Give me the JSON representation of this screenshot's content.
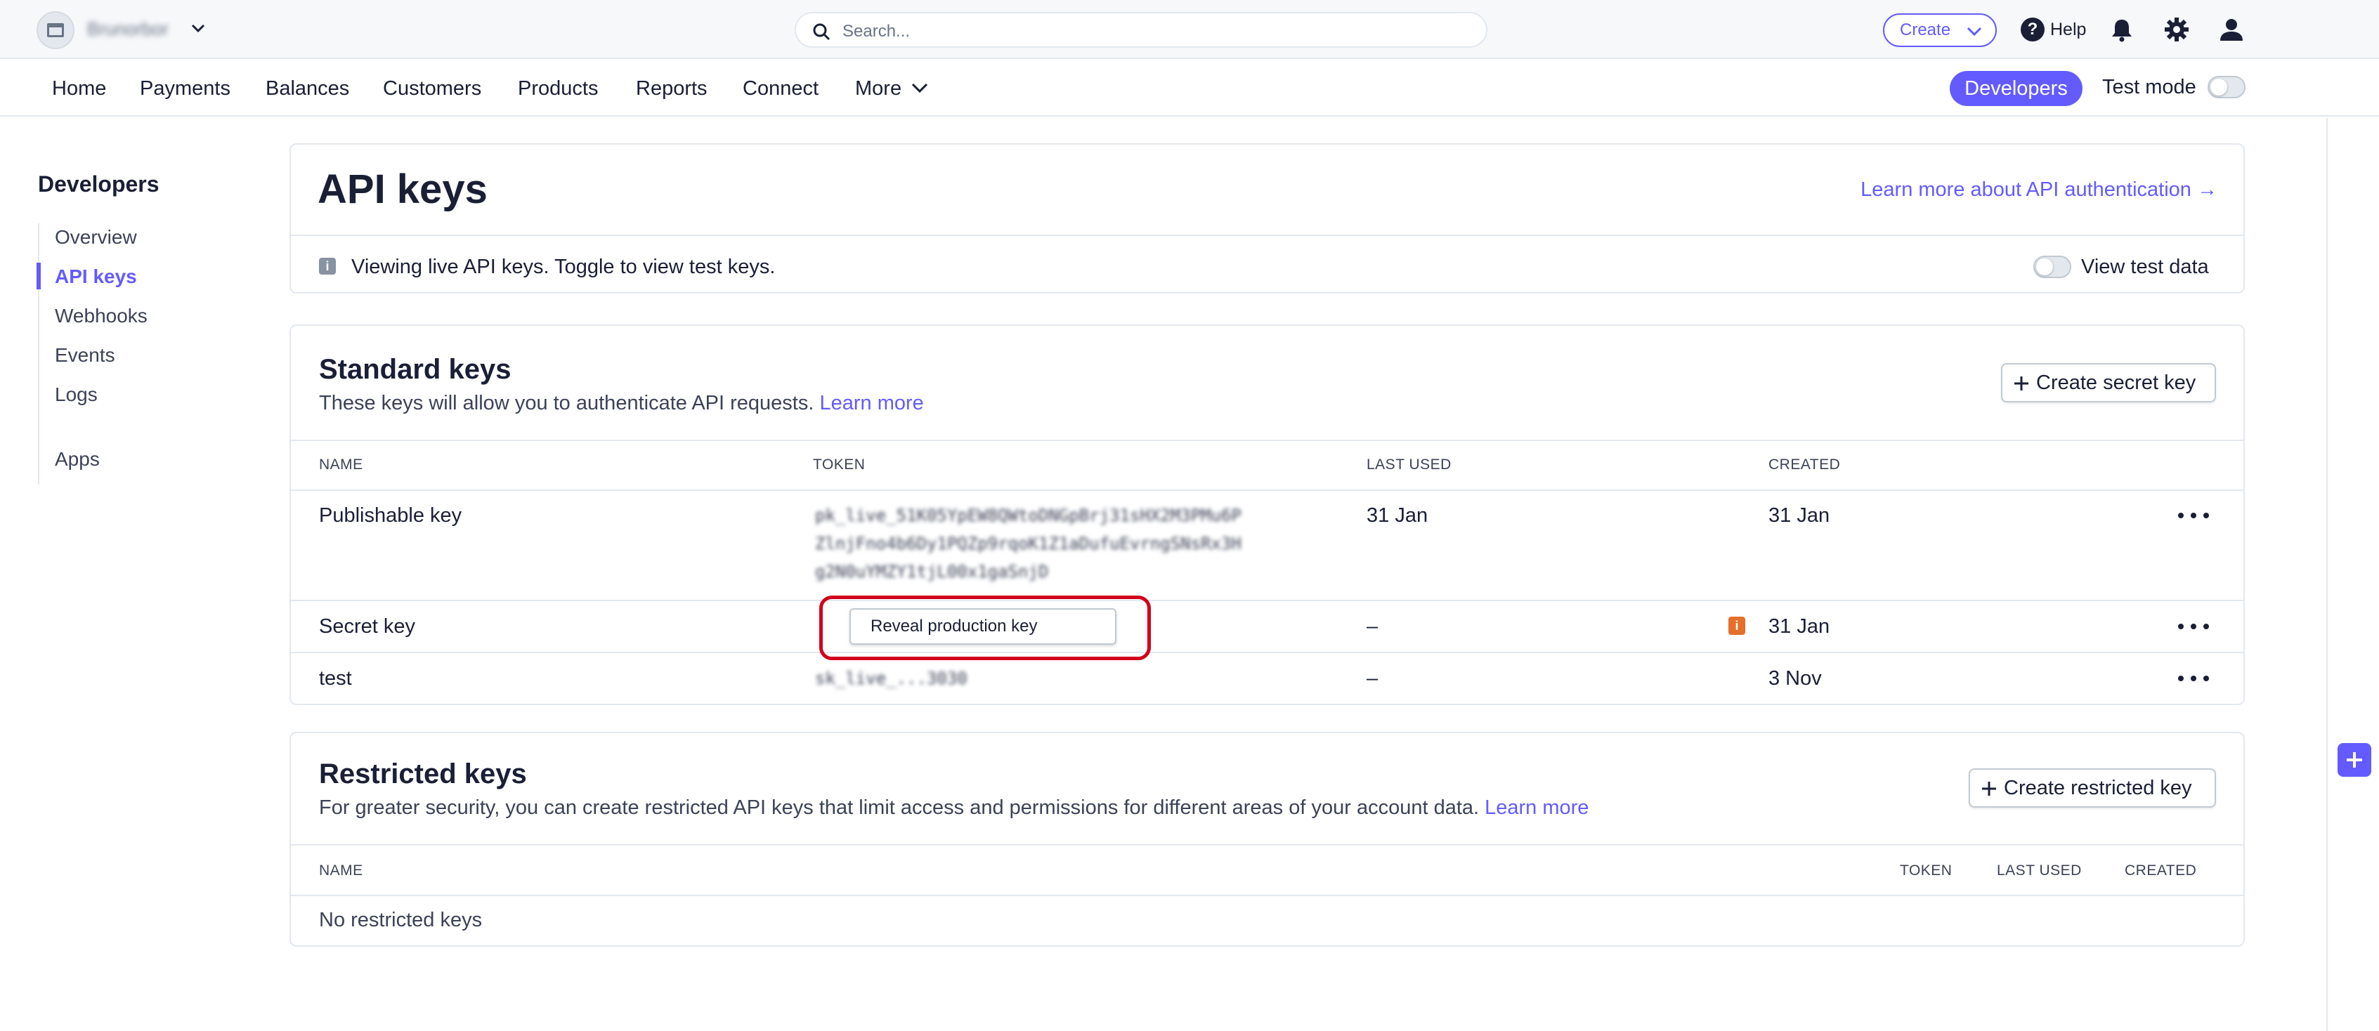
{
  "topbar": {
    "account_name": "Brunorbor",
    "search_placeholder": "Search...",
    "create_label": "Create",
    "help_label": "Help"
  },
  "nav": {
    "items": [
      "Home",
      "Payments",
      "Balances",
      "Customers",
      "Products",
      "Reports",
      "Connect",
      "More"
    ],
    "developers_label": "Developers",
    "test_mode_label": "Test mode"
  },
  "sidebar": {
    "title": "Developers",
    "items": [
      "Overview",
      "API keys",
      "Webhooks",
      "Events",
      "Logs",
      "Apps"
    ],
    "active": "API keys"
  },
  "page": {
    "title": "API keys",
    "learn_more_auth": "Learn more about API authentication →",
    "info_text": "Viewing live API keys. Toggle to view test keys.",
    "view_test_data": "View test data"
  },
  "standard_keys": {
    "title": "Standard keys",
    "subtitle": "These keys will allow you to authenticate API requests.",
    "learn_more": "Learn more",
    "create_button": "Create secret key",
    "columns": [
      "NAME",
      "TOKEN",
      "LAST USED",
      "CREATED"
    ],
    "rows": [
      {
        "name": "Publishable key",
        "token_lines": [
          "pk_live_51K05YpEW8QWtoDNGpBrj31sHX2M3PMu6P",
          "ZlnjFno4b6Dy1PQZp9rqoK1Z1aDufuEvrngSNsRx3H",
          "g2N0uYMZY1tjL00x1gaSnjD"
        ],
        "last_used": "31 Jan",
        "created": "31 Jan"
      },
      {
        "name": "Secret key",
        "reveal_label": "Reveal production key",
        "last_used": "–",
        "created": "31 Jan"
      },
      {
        "name": "test",
        "token": "sk_live_...3030",
        "last_used": "–",
        "created": "3 Nov"
      }
    ]
  },
  "restricted_keys": {
    "title": "Restricted keys",
    "subtitle": "For greater security, you can create restricted API keys that limit access and permissions for different areas of your account data.",
    "learn_more": "Learn more",
    "create_button": "Create restricted key",
    "columns": [
      "NAME",
      "TOKEN",
      "LAST USED",
      "CREATED"
    ],
    "empty_text": "No restricted keys"
  },
  "colors": {
    "accent": "#635bff",
    "highlight": "#d0021b",
    "warning": "#e56f2b"
  }
}
